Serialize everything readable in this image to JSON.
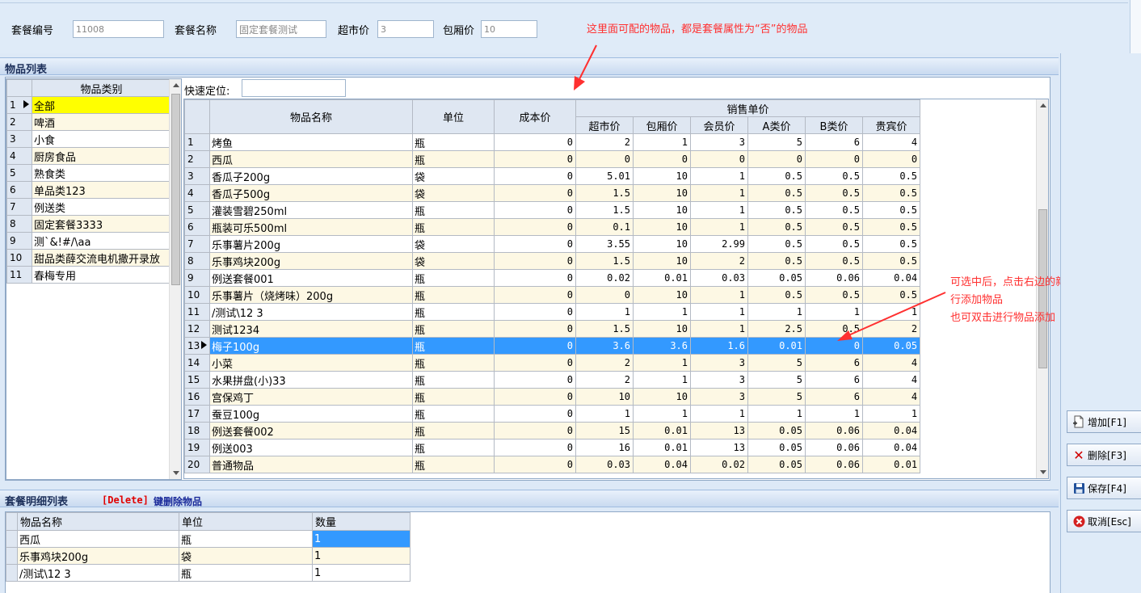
{
  "header": {
    "code_label": "套餐编号",
    "code_value": "11008",
    "name_label": "套餐名称",
    "name_value": "固定套餐测试",
    "market_label": "超市价",
    "market_value": "3",
    "room_label": "包厢价",
    "room_value": "10"
  },
  "annotations": {
    "top_note": "这里面可配的物品，都是套餐属性为“否”的物品",
    "side_note_line1": "可选中后，点击右边的新增，进",
    "side_note_line2": "行添加物品",
    "side_note_line3": "也可双击进行物品添加"
  },
  "item_list": {
    "title": "物品列表",
    "quick_locate_label": "快速定位:",
    "quick_locate_value": ""
  },
  "categories": {
    "header": "物品类别",
    "selected_row": 1,
    "rows": [
      {
        "no": "1",
        "name": "全部"
      },
      {
        "no": "2",
        "name": "啤酒"
      },
      {
        "no": "3",
        "name": "小食"
      },
      {
        "no": "4",
        "name": "厨房食品"
      },
      {
        "no": "5",
        "name": "熟食类"
      },
      {
        "no": "6",
        "name": "单品类123"
      },
      {
        "no": "7",
        "name": "例送类"
      },
      {
        "no": "8",
        "name": "固定套餐3333"
      },
      {
        "no": "9",
        "name": "测`&!#/\\aa"
      },
      {
        "no": "10",
        "name": "甜品类薛交流电机撒开录放"
      },
      {
        "no": "11",
        "name": "春梅专用"
      }
    ]
  },
  "products": {
    "headers": {
      "name": "物品名称",
      "unit": "单位",
      "cost": "成本价",
      "sale_group": "销售单价",
      "market": "超市价",
      "room": "包厢价",
      "member": "会员价",
      "a_price": "A类价",
      "b_price": "B类价",
      "vip": "贵宾价"
    },
    "selected_row": 13,
    "rows": [
      {
        "no": "1",
        "name": "烤鱼",
        "unit": "瓶",
        "cost": "0",
        "market": "2",
        "room": "1",
        "member": "3",
        "a": "5",
        "b": "6",
        "vip": "4"
      },
      {
        "no": "2",
        "name": "西瓜",
        "unit": "瓶",
        "cost": "0",
        "market": "0",
        "room": "0",
        "member": "0",
        "a": "0",
        "b": "0",
        "vip": "0"
      },
      {
        "no": "3",
        "name": "香瓜子200g",
        "unit": "袋",
        "cost": "0",
        "market": "5.01",
        "room": "10",
        "member": "1",
        "a": "0.5",
        "b": "0.5",
        "vip": "0.5"
      },
      {
        "no": "4",
        "name": "香瓜子500g",
        "unit": "袋",
        "cost": "0",
        "market": "1.5",
        "room": "10",
        "member": "1",
        "a": "0.5",
        "b": "0.5",
        "vip": "0.5"
      },
      {
        "no": "5",
        "name": "灌装雪碧250ml",
        "unit": "瓶",
        "cost": "0",
        "market": "1.5",
        "room": "10",
        "member": "1",
        "a": "0.5",
        "b": "0.5",
        "vip": "0.5"
      },
      {
        "no": "6",
        "name": "瓶装可乐500ml",
        "unit": "瓶",
        "cost": "0",
        "market": "0.1",
        "room": "10",
        "member": "1",
        "a": "0.5",
        "b": "0.5",
        "vip": "0.5"
      },
      {
        "no": "7",
        "name": "乐事薯片200g",
        "unit": "袋",
        "cost": "0",
        "market": "3.55",
        "room": "10",
        "member": "2.99",
        "a": "0.5",
        "b": "0.5",
        "vip": "0.5"
      },
      {
        "no": "8",
        "name": "乐事鸡块200g",
        "unit": "袋",
        "cost": "0",
        "market": "1.5",
        "room": "10",
        "member": "2",
        "a": "0.5",
        "b": "0.5",
        "vip": "0.5"
      },
      {
        "no": "9",
        "name": "例送套餐001",
        "unit": "瓶",
        "cost": "0",
        "market": "0.02",
        "room": "0.01",
        "member": "0.03",
        "a": "0.05",
        "b": "0.06",
        "vip": "0.04"
      },
      {
        "no": "10",
        "name": "乐事薯片（烧烤味）200g",
        "unit": "瓶",
        "cost": "0",
        "market": "0",
        "room": "10",
        "member": "1",
        "a": "0.5",
        "b": "0.5",
        "vip": "0.5"
      },
      {
        "no": "11",
        "name": "/测试\\12 3",
        "unit": "瓶",
        "cost": "0",
        "market": "1",
        "room": "1",
        "member": "1",
        "a": "1",
        "b": "1",
        "vip": "1"
      },
      {
        "no": "12",
        "name": "测试1234",
        "unit": "瓶",
        "cost": "0",
        "market": "1.5",
        "room": "10",
        "member": "1",
        "a": "2.5",
        "b": "0.5",
        "vip": "2"
      },
      {
        "no": "13",
        "name": "梅子100g",
        "unit": "瓶",
        "cost": "0",
        "market": "3.6",
        "room": "3.6",
        "member": "1.6",
        "a": "0.01",
        "b": "0",
        "vip": "0.05"
      },
      {
        "no": "14",
        "name": "小菜",
        "unit": "瓶",
        "cost": "0",
        "market": "2",
        "room": "1",
        "member": "3",
        "a": "5",
        "b": "6",
        "vip": "4"
      },
      {
        "no": "15",
        "name": "水果拼盘(小)33",
        "unit": "瓶",
        "cost": "0",
        "market": "2",
        "room": "1",
        "member": "3",
        "a": "5",
        "b": "6",
        "vip": "4"
      },
      {
        "no": "16",
        "name": "宫保鸡丁",
        "unit": "瓶",
        "cost": "0",
        "market": "10",
        "room": "10",
        "member": "3",
        "a": "5",
        "b": "6",
        "vip": "4"
      },
      {
        "no": "17",
        "name": "蚕豆100g",
        "unit": "瓶",
        "cost": "0",
        "market": "1",
        "room": "1",
        "member": "1",
        "a": "1",
        "b": "1",
        "vip": "1"
      },
      {
        "no": "18",
        "name": "例送套餐002",
        "unit": "瓶",
        "cost": "0",
        "market": "15",
        "room": "0.01",
        "member": "13",
        "a": "0.05",
        "b": "0.06",
        "vip": "0.04"
      },
      {
        "no": "19",
        "name": "例送003",
        "unit": "瓶",
        "cost": "0",
        "market": "16",
        "room": "0.01",
        "member": "13",
        "a": "0.05",
        "b": "0.06",
        "vip": "0.04"
      },
      {
        "no": "20",
        "name": "普通物品",
        "unit": "瓶",
        "cost": "0",
        "market": "0.03",
        "room": "0.04",
        "member": "0.02",
        "a": "0.05",
        "b": "0.06",
        "vip": "0.01"
      }
    ]
  },
  "detail_list": {
    "title": "套餐明细列表",
    "note_key": "[Delete]",
    "note_text": "键删除物品",
    "headers": {
      "name": "物品名称",
      "unit": "单位",
      "qty": "数量"
    },
    "rows": [
      {
        "name": "西瓜",
        "unit": "瓶",
        "qty": "1"
      },
      {
        "name": "乐事鸡块200g",
        "unit": "袋",
        "qty": "1"
      },
      {
        "name": "/测试\\12 3",
        "unit": "瓶",
        "qty": "1"
      }
    ]
  },
  "actions": {
    "add": "增加[F1]",
    "delete": "删除[F3]",
    "save": "保存[F4]",
    "cancel": "取消[Esc]"
  },
  "colors": {
    "selected": "#3399ff",
    "highlight": "#ffff00",
    "annotation": "#ff3030"
  }
}
